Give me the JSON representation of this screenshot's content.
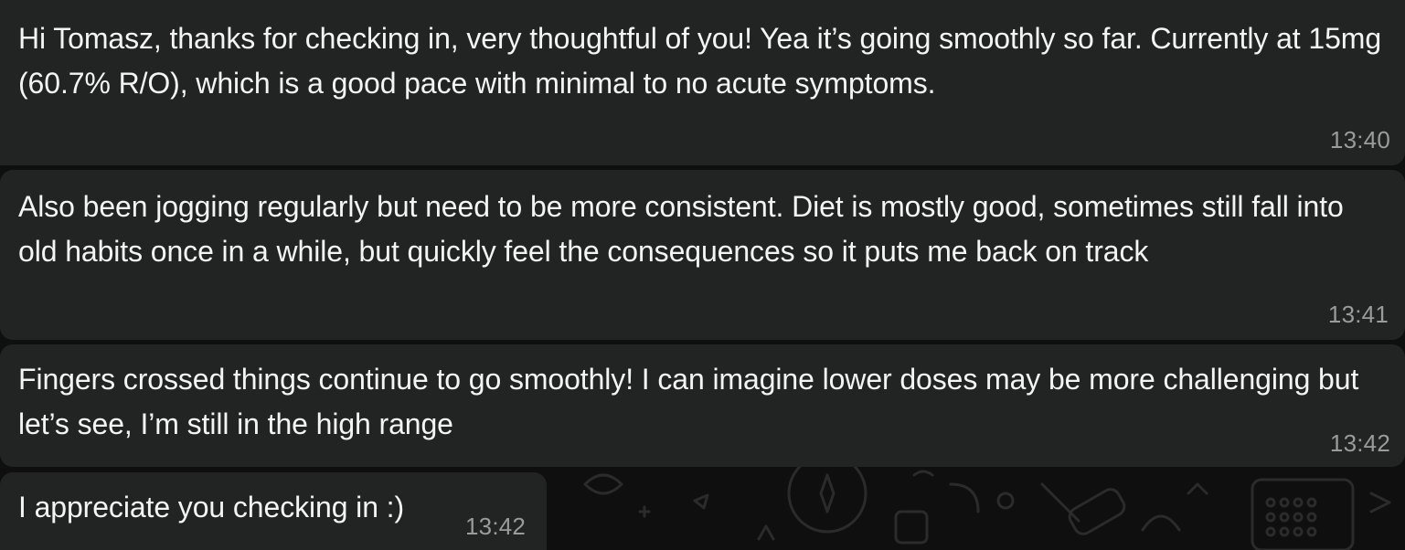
{
  "messages": [
    {
      "text": "Hi Tomasz, thanks for checking in, very thoughtful of you! Yea it’s going smoothly so far. Currently at 15mg (60.7% R/O), which is a good pace with minimal to no acute symptoms.",
      "time": "13:40"
    },
    {
      "text": "Also been jogging regularly but need to be more consistent. Diet is mostly good, sometimes still fall into old habits once in a while, but quickly feel the consequences so it puts me back on track",
      "time": "13:41"
    },
    {
      "text": "Fingers crossed things continue to go smoothly! I can imagine lower doses may be more challenging but let’s see, I’m still in the high range",
      "time": "13:42"
    },
    {
      "text": "I appreciate you checking in :)",
      "time": "13:42"
    }
  ],
  "colors": {
    "background": "#0f0f0f",
    "bubble": "#222323",
    "text": "#f4f4f4",
    "time": "#9a9b9b",
    "doodle": "#2a2a2a"
  }
}
